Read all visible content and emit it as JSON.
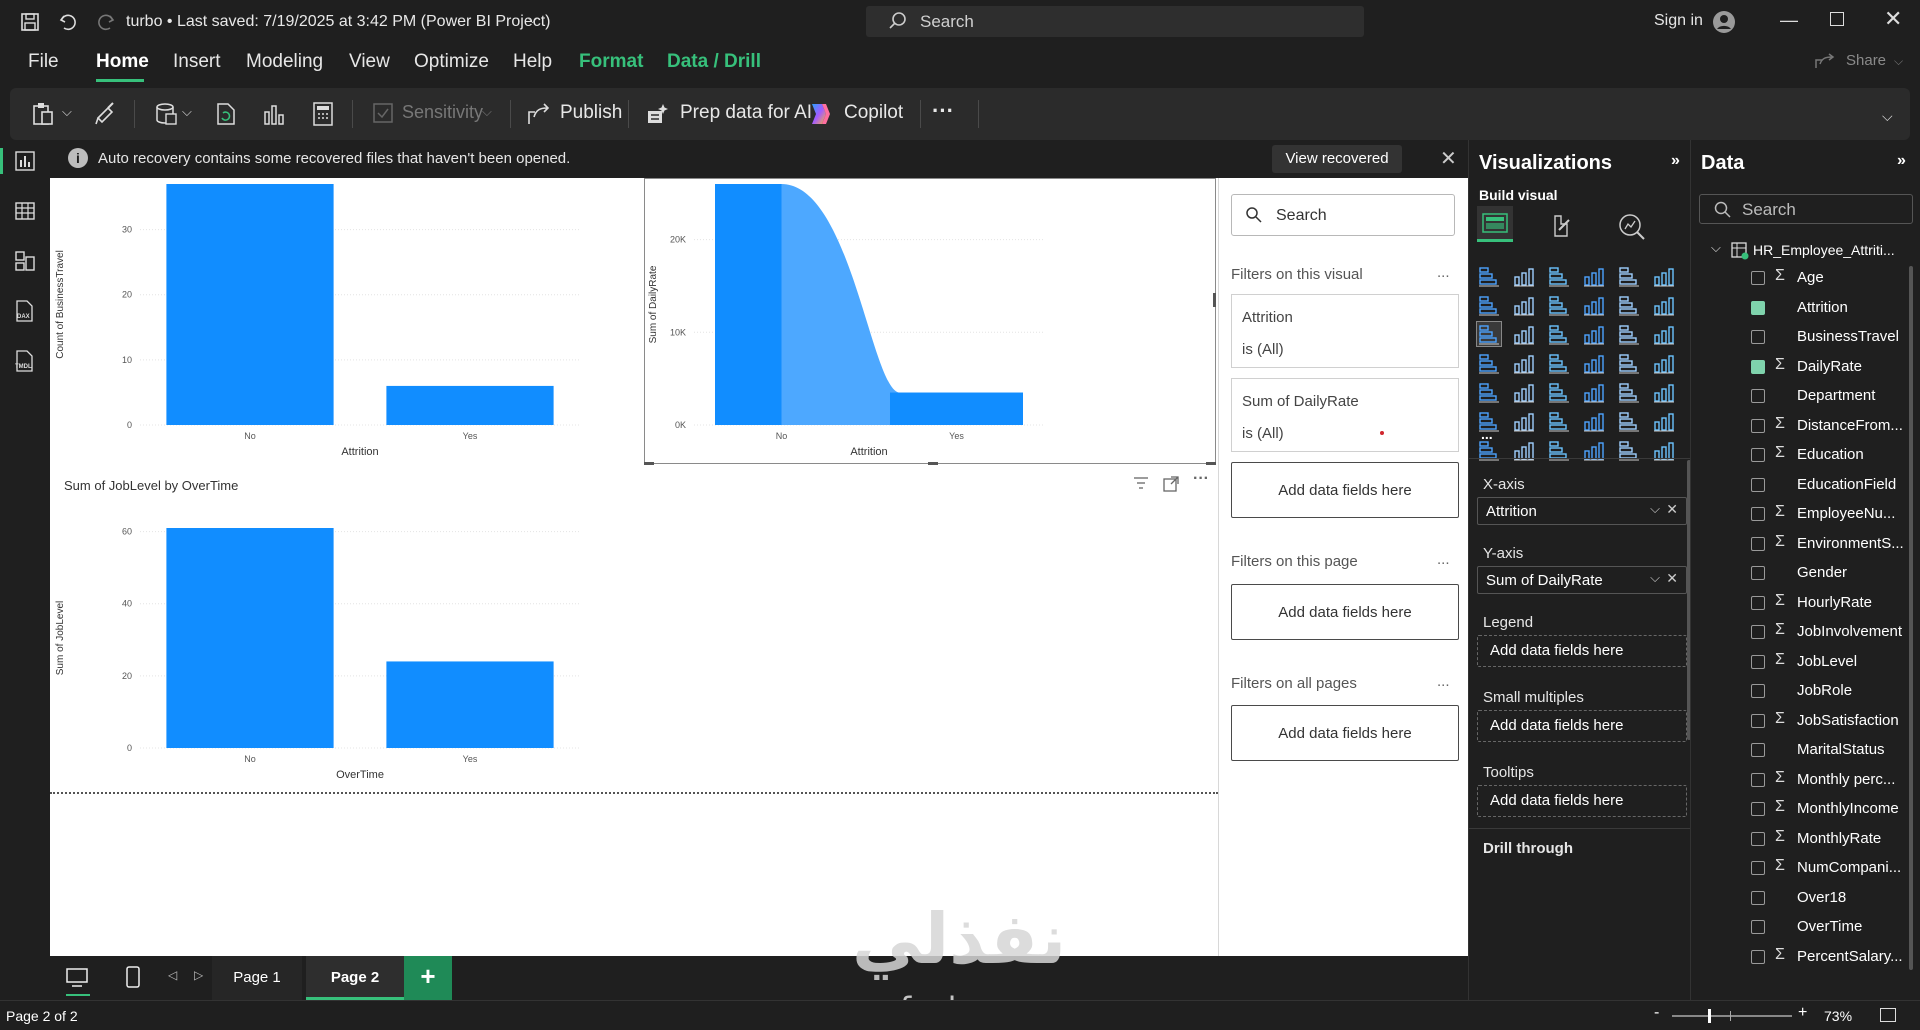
{
  "titlebar": {
    "title": "turbo • Last saved: 7/19/2025 at 3:42 PM (Power BI Project)",
    "search_placeholder": "Search",
    "sign_in": "Sign in"
  },
  "menu": {
    "items": [
      "File",
      "Home",
      "Insert",
      "Modeling",
      "View",
      "Optimize",
      "Help",
      "Format",
      "Data / Drill"
    ],
    "active": "Home",
    "share": "Share"
  },
  "ribbon": {
    "sensitivity": "Sensitivity",
    "publish": "Publish",
    "prep_data": "Prep data for AI",
    "copilot": "Copilot",
    "more": "···"
  },
  "notice": {
    "text": "Auto recovery contains some recovered files that haven't been opened.",
    "button": "View recovered files"
  },
  "filters": {
    "search_placeholder": "Search",
    "on_visual": "Filters on this visual",
    "card1_title": "Attrition",
    "card1_value": "is (All)",
    "card2_title": "Sum of DailyRate",
    "card2_value": "is (All)",
    "add_fields": "Add data fields here",
    "on_page": "Filters on this page",
    "on_all": "Filters on all pages",
    "dots": "..."
  },
  "viz": {
    "title": "Visualizations",
    "build": "Build visual",
    "xaxis": "X-axis",
    "xaxis_field": "Attrition",
    "yaxis": "Y-axis",
    "yaxis_field": "Sum of DailyRate",
    "legend": "Legend",
    "small_multiples": "Small multiples",
    "tooltips": "Tooltips",
    "add_fields": "Add data fields here",
    "drill_through": "Drill through",
    "more": "..."
  },
  "data_pane": {
    "title": "Data",
    "search_placeholder": "Search",
    "table_name": "HR_Employee_Attriti...",
    "fields": [
      {
        "name": "Age",
        "sigma": true,
        "checked": false
      },
      {
        "name": "Attrition",
        "sigma": false,
        "checked": true
      },
      {
        "name": "BusinessTravel",
        "sigma": false,
        "checked": false
      },
      {
        "name": "DailyRate",
        "sigma": true,
        "checked": true
      },
      {
        "name": "Department",
        "sigma": false,
        "checked": false
      },
      {
        "name": "DistanceFrom...",
        "sigma": true,
        "checked": false
      },
      {
        "name": "Education",
        "sigma": true,
        "checked": false
      },
      {
        "name": "EducationField",
        "sigma": false,
        "checked": false
      },
      {
        "name": "EmployeeNu...",
        "sigma": true,
        "checked": false
      },
      {
        "name": "EnvironmentS...",
        "sigma": true,
        "checked": false
      },
      {
        "name": "Gender",
        "sigma": false,
        "checked": false
      },
      {
        "name": "HourlyRate",
        "sigma": true,
        "checked": false
      },
      {
        "name": "JobInvolvement",
        "sigma": true,
        "checked": false
      },
      {
        "name": "JobLevel",
        "sigma": true,
        "checked": false
      },
      {
        "name": "JobRole",
        "sigma": false,
        "checked": false
      },
      {
        "name": "JobSatisfaction",
        "sigma": true,
        "checked": false
      },
      {
        "name": "MaritalStatus",
        "sigma": false,
        "checked": false
      },
      {
        "name": "Monthly perc...",
        "sigma": true,
        "checked": false
      },
      {
        "name": "MonthlyIncome",
        "sigma": true,
        "checked": false
      },
      {
        "name": "MonthlyRate",
        "sigma": true,
        "checked": false
      },
      {
        "name": "NumCompani...",
        "sigma": true,
        "checked": false
      },
      {
        "name": "Over18",
        "sigma": false,
        "checked": false
      },
      {
        "name": "OverTime",
        "sigma": false,
        "checked": false
      },
      {
        "name": "PercentSalary...",
        "sigma": true,
        "checked": false
      }
    ]
  },
  "pages": {
    "tabs": [
      "Page 1",
      "Page 2"
    ],
    "active": "Page 2",
    "add": "+"
  },
  "status": {
    "page_info": "Page 2 of 2",
    "zoom": "73%",
    "zoom_minus": "-",
    "zoom_plus": "+"
  },
  "watermark": {
    "arabic": "نفذلي",
    "latin": "nafezly.com"
  },
  "colors": {
    "accent_green": "#37c07b",
    "bar_blue": "#118dff",
    "area_light": "#4da8ff"
  },
  "chart_data": [
    {
      "type": "bar",
      "title": "",
      "categories": [
        "No",
        "Yes"
      ],
      "values": [
        37,
        6
      ],
      "xlabel": "Attrition",
      "ylabel": "Count of BusinessTravel",
      "ylim": [
        0,
        37
      ],
      "yticks": [
        "0",
        "10",
        "20",
        "30"
      ],
      "grid": true
    },
    {
      "type": "area",
      "title": "",
      "categories": [
        "No",
        "Yes"
      ],
      "values": [
        26000,
        3500
      ],
      "xlabel": "Attrition",
      "ylabel": "Sum of DailyRate",
      "ylim": [
        0,
        26000
      ],
      "yticks": [
        "0K",
        "10K",
        "20K"
      ],
      "grid": true
    },
    {
      "type": "bar",
      "title": "Sum of JobLevel by OverTime",
      "categories": [
        "No",
        "Yes"
      ],
      "values": [
        61,
        24
      ],
      "xlabel": "OverTime",
      "ylabel": "Sum of JobLevel",
      "ylim": [
        0,
        61
      ],
      "yticks": [
        "0",
        "20",
        "40",
        "60"
      ],
      "grid": true
    }
  ]
}
